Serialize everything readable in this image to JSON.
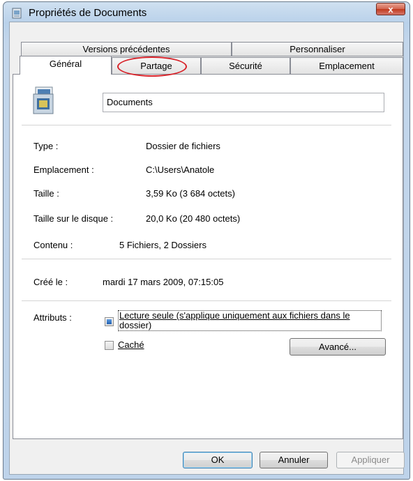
{
  "window": {
    "title": "Propriétés de Documents",
    "close_label": "x"
  },
  "tabs": {
    "row1": [
      {
        "label": "Versions précédentes"
      },
      {
        "label": "Personnaliser"
      }
    ],
    "row2": [
      {
        "label": "Général",
        "active": true
      },
      {
        "label": "Partage"
      },
      {
        "label": "Sécurité"
      },
      {
        "label": "Emplacement"
      }
    ]
  },
  "general": {
    "folder_name": "Documents",
    "properties": [
      {
        "label": "Type :",
        "value": "Dossier de fichiers"
      },
      {
        "label": "Emplacement :",
        "value": "C:\\Users\\Anatole"
      },
      {
        "label": "Taille :",
        "value": "3,59 Ko (3 684 octets)"
      },
      {
        "label": "Taille sur le disque :",
        "value": "20,0 Ko (20 480 octets)"
      },
      {
        "label": "Contenu :",
        "value": "5 Fichiers, 2 Dossiers"
      }
    ],
    "created": {
      "label": "Créé le :",
      "value": "mardi 17 mars 2009, 07:15:05"
    },
    "attributes": {
      "label": "Attributs :",
      "readonly_line1": "Lecture seule (s'applique uniquement aux fichiers dans le",
      "readonly_line2": "dossier)",
      "hidden": "Caché",
      "advanced": "Avancé..."
    }
  },
  "buttons": {
    "ok": "OK",
    "cancel": "Annuler",
    "apply": "Appliquer"
  },
  "colors": {
    "annotation": "#d8232a"
  }
}
